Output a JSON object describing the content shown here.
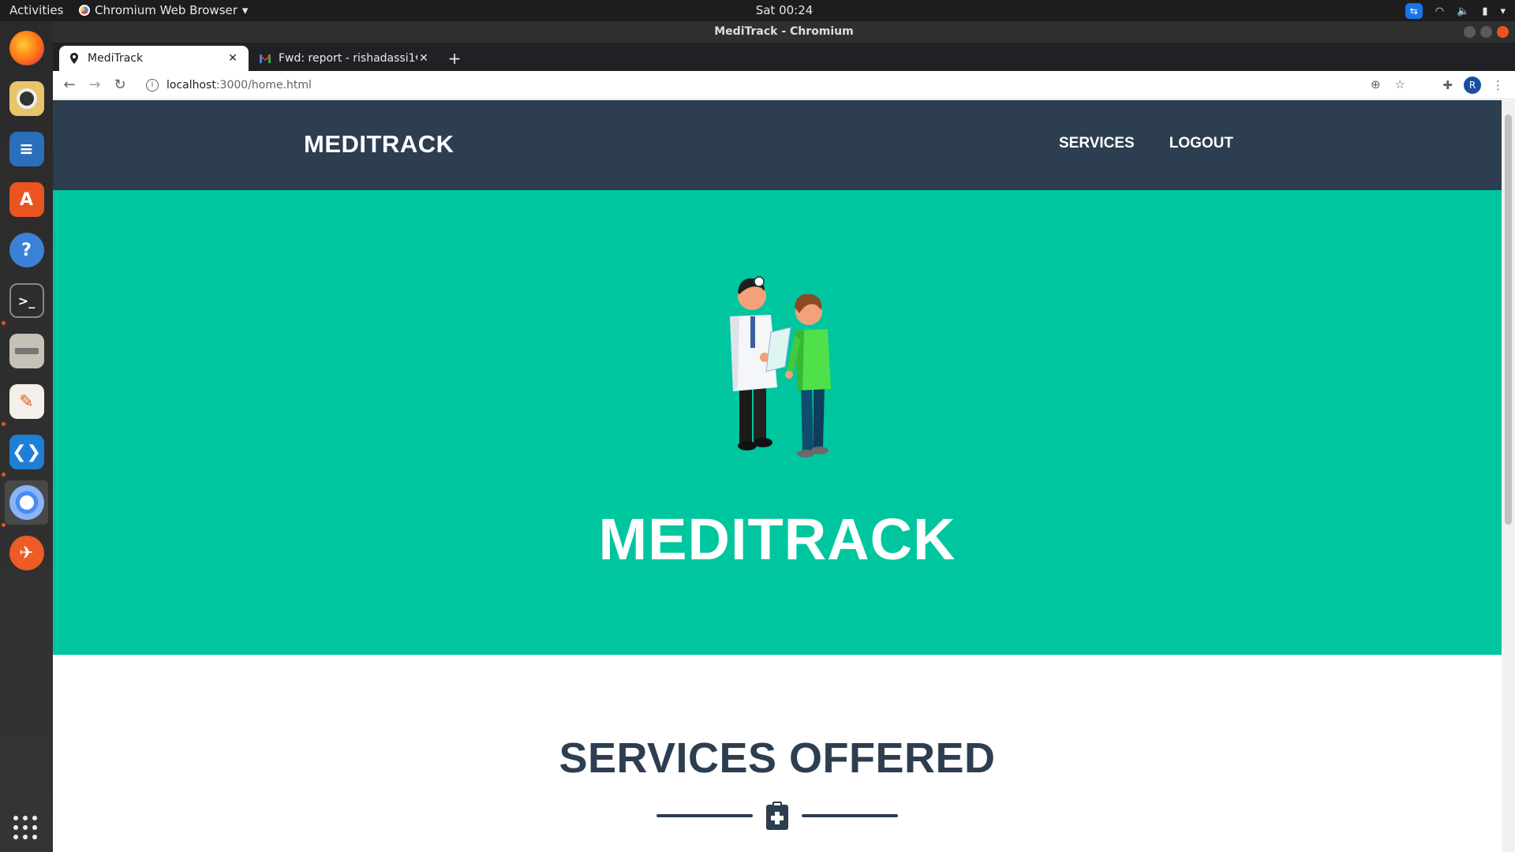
{
  "os": {
    "activities_label": "Activities",
    "app_menu_label": "Chromium Web Browser",
    "clock": "Sat 00:24"
  },
  "window": {
    "title": "MediTrack - Chromium"
  },
  "tabs": [
    {
      "label": "MediTrack",
      "active": true
    },
    {
      "label": "Fwd: report - rishadassi1€",
      "active": false
    }
  ],
  "address_bar": {
    "host": "localhost",
    "path": ":3000/home.html"
  },
  "profile_initial": "R",
  "site": {
    "brand": "MEDITRACK",
    "nav": {
      "services": "SERVICES",
      "logout": "LOGOUT"
    },
    "hero": {
      "title": "MEDITRACK"
    },
    "services_section": {
      "heading": "SERVICES OFFERED"
    }
  },
  "colors": {
    "nav_bg": "#2c3e50",
    "hero_bg": "#00c6a0",
    "heading_text": "#2c3e50"
  },
  "icons": {
    "divider": "clipboard-medical-icon",
    "hero": "doctor-patient-illustration"
  }
}
